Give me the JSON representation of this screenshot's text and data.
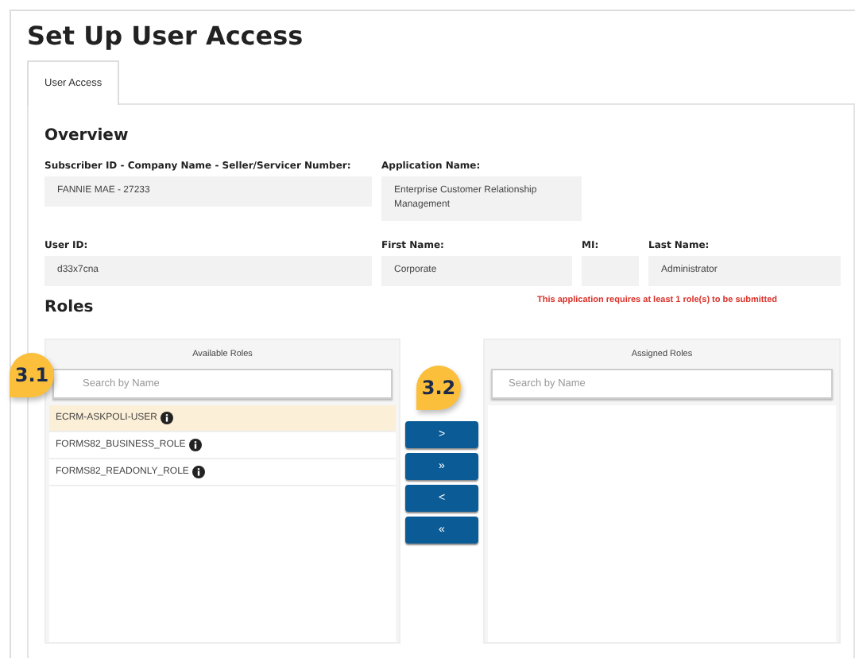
{
  "title": "Set Up User Access",
  "tabs": [
    {
      "label": "User Access",
      "selected": true
    }
  ],
  "overview": {
    "heading": "Overview",
    "fields": [
      {
        "label": "Subscriber ID - Company Name - Seller/Servicer Number:",
        "value": "FANNIE MAE - 27233"
      },
      {
        "label": "Application Name:",
        "value": "Enterprise Customer Relationship Management"
      },
      {
        "label": "User ID:",
        "value": "d33x7cna"
      },
      {
        "label": "First Name:",
        "value": "Corporate"
      },
      {
        "label": "MI:"
      },
      {
        "label": "Last Name:",
        "value": "Administrator"
      }
    ]
  },
  "roles": {
    "heading": "Roles",
    "warning": "This application requires at least 1 role(s) to be submitted",
    "available": {
      "title": "Available Roles",
      "placeholder": "Search by Name",
      "items": [
        {
          "name": "ECRM-ASKPOLI-USER",
          "selected": true
        },
        {
          "name": "FORMS82_BUSINESS_ROLE",
          "selected": false
        },
        {
          "name": "FORMS82_READONLY_ROLE",
          "selected": false
        }
      ]
    },
    "buttons": [
      ">",
      "»",
      "<",
      "«"
    ],
    "assigned": {
      "title": "Assigned Roles",
      "placeholder": "Search by Name"
    }
  },
  "callouts": [
    "3.1",
    "3.2"
  ]
}
